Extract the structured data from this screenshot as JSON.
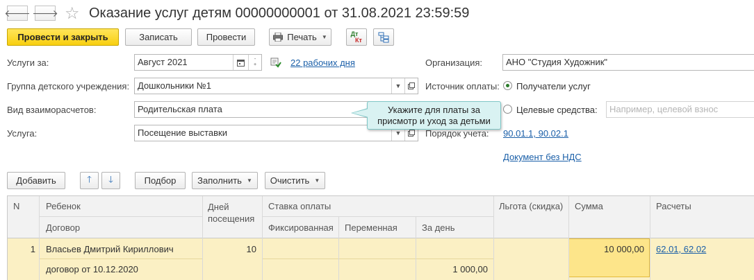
{
  "header": {
    "title": "Оказание услуг детям 00000000001 от 31.08.2021 23:59:59",
    "back_glyph": "🡐",
    "forward_glyph": "🡒",
    "star_glyph": "☆"
  },
  "toolbar": {
    "post_close": "Провести и закрыть",
    "save": "Записать",
    "post": "Провести",
    "print": "Печать",
    "dtkt_top": "Дт",
    "dtkt_bottom": "Кт"
  },
  "form": {
    "services_for_label": "Услуги за:",
    "services_for_value": "Август 2021",
    "work_days_link": "22 рабочих дня",
    "group_label": "Группа детского учреждения:",
    "group_value": "Дошкольники №1",
    "settlement_type_label": "Вид взаиморасчетов:",
    "settlement_type_value": "Родительская плата",
    "service_label": "Услуга:",
    "service_value": "Посещение выставки",
    "organization_label": "Организация:",
    "organization_value": "АНО \"Студия Художник\"",
    "payment_source_label": "Источник оплаты:",
    "payment_source_option1": "Получатели услуг",
    "payment_source_option2": "Целевые средства:",
    "target_funds_placeholder": "Например, целевой взнос",
    "accounting_order_label": "Порядок учета:",
    "accounting_order_link": "90.01.1, 90.02.1",
    "vat_link": "Документ без НДС"
  },
  "tooltip": {
    "line1": "Укажите для платы за",
    "line2": "присмотр и уход за детьми"
  },
  "table_toolbar": {
    "add": "Добавить",
    "select": "Подбор",
    "fill": "Заполнить",
    "clear": "Очистить"
  },
  "table": {
    "headers": {
      "n": "N",
      "child": "Ребенок",
      "contract": "Договор",
      "days_line1": "Дней",
      "days_line2": "посещения",
      "rate": "Ставка оплаты",
      "fixed": "Фиксированная",
      "variable": "Переменная",
      "per_day": "За день",
      "benefit": "Льгота (скидка)",
      "sum": "Сумма",
      "calc": "Расчеты"
    },
    "rows": [
      {
        "n": "1",
        "child": "Власьев Дмитрий Кириллович",
        "contract": "договор от 10.12.2020",
        "days": "10",
        "per_day": "1 000,00",
        "sum": "10 000,00",
        "calc": "62.01, 62.02"
      }
    ]
  },
  "colors": {
    "primary_button": "#f8cf10",
    "link": "#1a5fa8",
    "row_highlight": "#fbf0c4",
    "active_cell": "#fde58a",
    "tooltip_bg": "#d9f2f2"
  }
}
